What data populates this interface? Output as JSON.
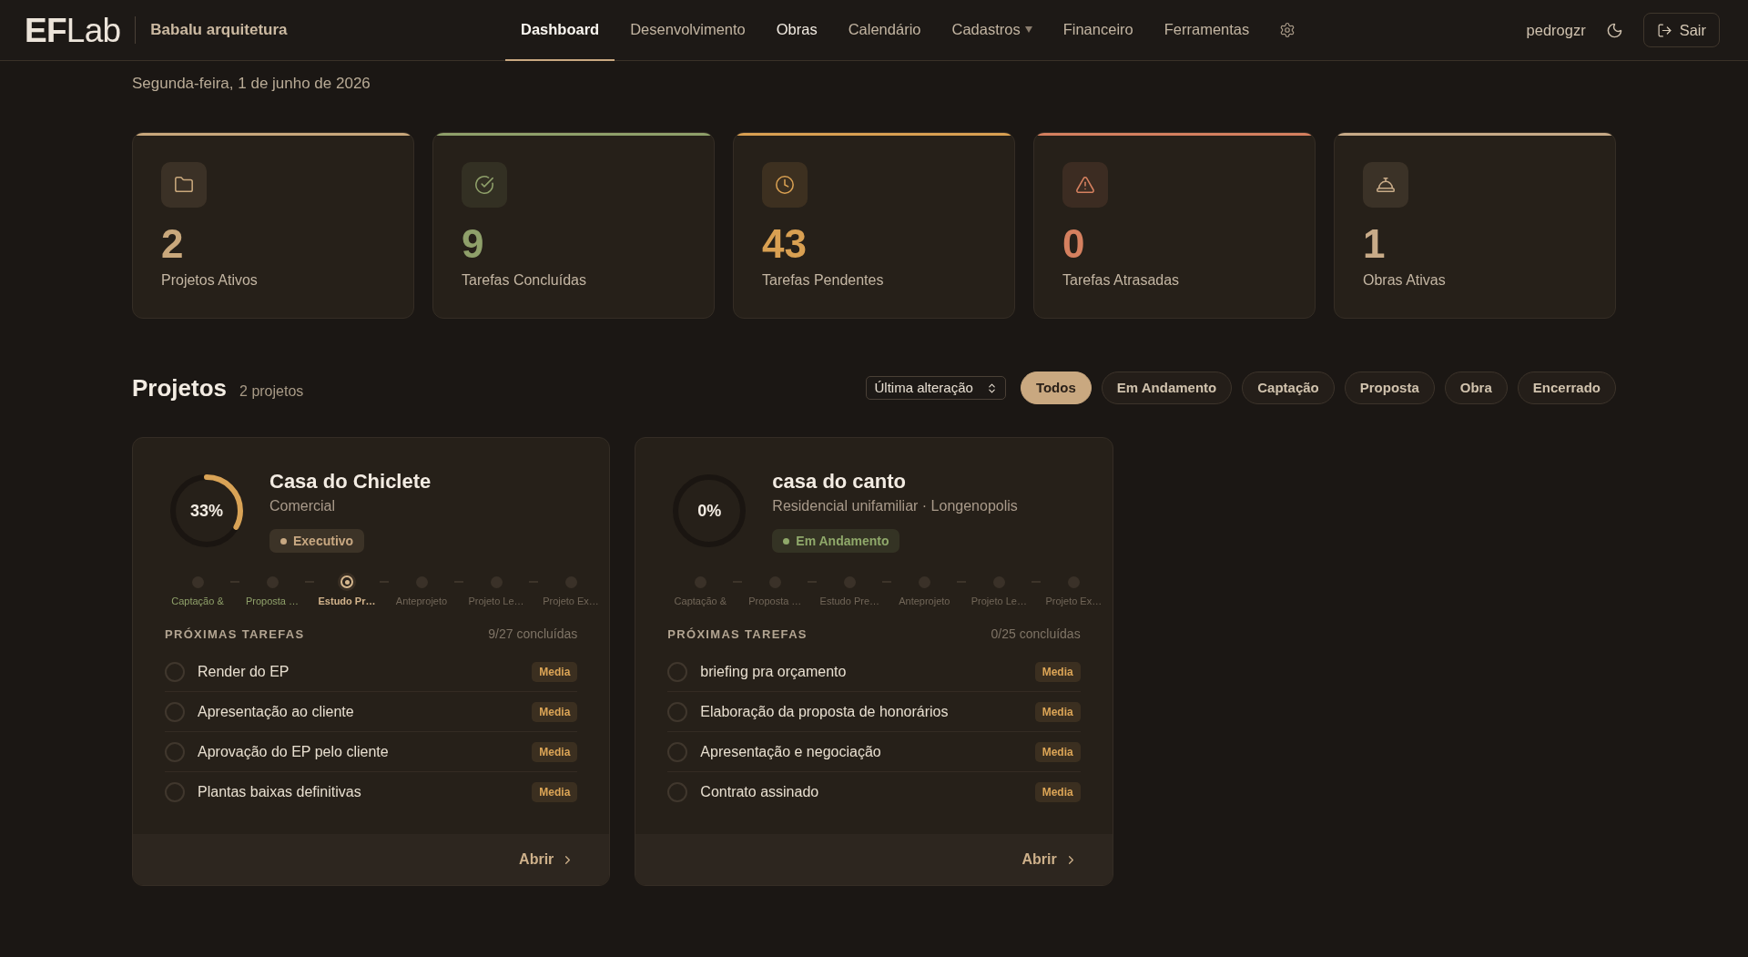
{
  "header": {
    "logo": "**EF**Lab",
    "workspace": "Babalu arquitetura",
    "nav": [
      {
        "label": "Dashboard",
        "selected": true,
        "highlighted": false,
        "menu": false
      },
      {
        "label": "Desenvolvimento",
        "selected": false,
        "highlighted": false,
        "menu": false
      },
      {
        "label": "Obras",
        "selected": false,
        "highlighted": true,
        "menu": false
      },
      {
        "label": "Calendário",
        "selected": false,
        "highlighted": false,
        "menu": false
      },
      {
        "label": "Cadastros",
        "selected": false,
        "highlighted": false,
        "menu": true
      },
      {
        "label": "Financeiro",
        "selected": false,
        "highlighted": false,
        "menu": false
      },
      {
        "label": "Ferramentas",
        "selected": false,
        "highlighted": false,
        "menu": false
      }
    ],
    "user": "pedrogzr",
    "logout": "Sair"
  },
  "date": "Segunda-feira, 1 de junho de 2026",
  "stats": [
    {
      "kind": "folder",
      "value": "2",
      "label": "Projetos Ativos",
      "color": "#c9a87c"
    },
    {
      "kind": "check",
      "value": "9",
      "label": "Tarefas Concluídas",
      "color": "#8fa06a"
    },
    {
      "kind": "clock",
      "value": "43",
      "label": "Tarefas Pendentes",
      "color": "#d9a052"
    },
    {
      "kind": "alert",
      "value": "0",
      "label": "Tarefas Atrasadas",
      "color": "#d5805f"
    },
    {
      "kind": "bell",
      "value": "1",
      "label": "Obras Ativas",
      "color": "#c8ab88"
    }
  ],
  "projects": {
    "title": "Projetos",
    "count": "2 projetos",
    "sort": "Última alteração",
    "filters": [
      {
        "label": "Todos",
        "selected": true
      },
      {
        "label": "Em Andamento",
        "selected": false
      },
      {
        "label": "Captação",
        "selected": false
      },
      {
        "label": "Proposta",
        "selected": false
      },
      {
        "label": "Obra",
        "selected": false
      },
      {
        "label": "Encerrado",
        "selected": false
      }
    ],
    "cards": [
      {
        "percent": "33%",
        "level": 0.33,
        "name": "Casa do Chiclete",
        "subtitle": "Comercial",
        "status": {
          "label": "Executivo",
          "color": "#c8a882"
        },
        "stages": [
          {
            "label": "Captação &",
            "done": true,
            "current": false
          },
          {
            "label": "Proposta …",
            "done": true,
            "current": false
          },
          {
            "label": "Estudo Pr…",
            "done": false,
            "current": true
          },
          {
            "label": "Anteprojeto",
            "done": false,
            "current": false
          },
          {
            "label": "Projeto Le…",
            "done": false,
            "current": false
          },
          {
            "label": "Projeto Ex…",
            "done": false,
            "current": false
          }
        ],
        "tasks_title": "PRÓXIMAS TAREFAS",
        "tasks_count": "9/27 concluídas",
        "tasks": [
          {
            "label": "Render do EP",
            "checked": false,
            "priority": "Media"
          },
          {
            "label": "Apresentação ao cliente",
            "checked": false,
            "priority": "Media"
          },
          {
            "label": "Aprovação do EP pelo cliente",
            "checked": false,
            "priority": "Media"
          },
          {
            "label": "Plantas baixas definitivas",
            "checked": false,
            "priority": "Media"
          }
        ],
        "open": "Abrir"
      },
      {
        "percent": "0%",
        "level": 0,
        "name": "casa do canto",
        "subtitle": "Residencial unifamiliar · Longenopolis",
        "status": {
          "label": "Em Andamento",
          "color": "#8fa86a"
        },
        "stages": [
          {
            "label": "Captação &",
            "done": false,
            "current": false
          },
          {
            "label": "Proposta …",
            "done": false,
            "current": false
          },
          {
            "label": "Estudo Pre…",
            "done": false,
            "current": false
          },
          {
            "label": "Anteprojeto",
            "done": false,
            "current": false
          },
          {
            "label": "Projeto Le…",
            "done": false,
            "current": false
          },
          {
            "label": "Projeto Ex…",
            "done": false,
            "current": false
          }
        ],
        "tasks_title": "PRÓXIMAS TAREFAS",
        "tasks_count": "0/25 concluídas",
        "tasks": [
          {
            "label": "briefing pra orçamento",
            "checked": false,
            "priority": "Media"
          },
          {
            "label": "Elaboração da proposta de honorários",
            "checked": false,
            "priority": "Media"
          },
          {
            "label": "Apresentação e negociação",
            "checked": false,
            "priority": "Media"
          },
          {
            "label": "Contrato assinado",
            "checked": false,
            "priority": "Media"
          }
        ],
        "open": "Abrir"
      }
    ]
  }
}
